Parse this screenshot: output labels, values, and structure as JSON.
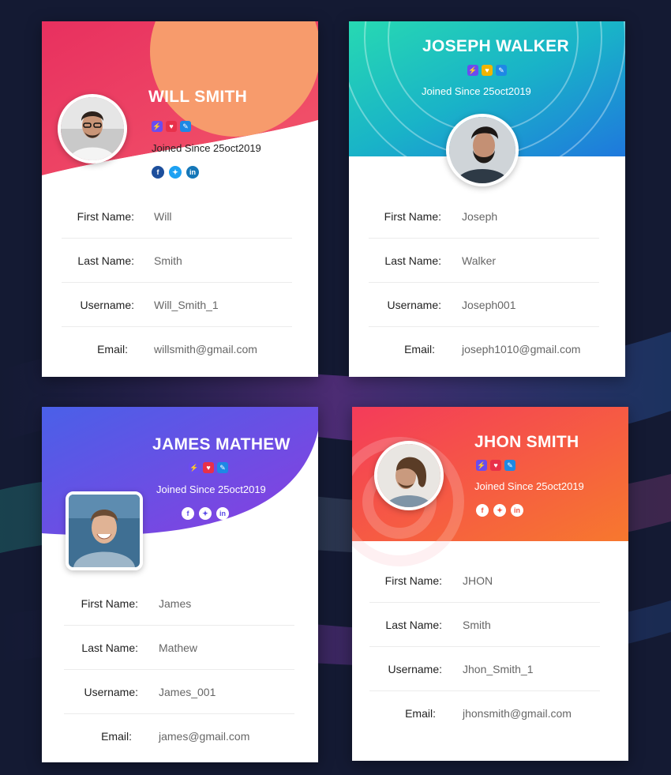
{
  "cards": [
    {
      "name": "WILL SMITH",
      "joined": "Joined Since 25oct2019",
      "badges": [
        "lightning-icon",
        "heart-icon",
        "pen-icon"
      ],
      "socials": [
        "facebook-icon",
        "twitter-icon",
        "linkedin-icon"
      ],
      "fields": [
        {
          "label": "First Name:",
          "value": "Will"
        },
        {
          "label": "Last Name:",
          "value": "Smith"
        },
        {
          "label": "Username:",
          "value": "Will_Smith_1"
        },
        {
          "label": "Email:",
          "value": "willsmith@gmail.com"
        }
      ]
    },
    {
      "name": "JOSEPH WALKER",
      "joined": "Joined Since 25oct2019",
      "badges": [
        "lightning-icon",
        "heart-icon",
        "pen-icon"
      ],
      "fields": [
        {
          "label": "First Name:",
          "value": "Joseph"
        },
        {
          "label": "Last Name:",
          "value": "Walker"
        },
        {
          "label": "Username:",
          "value": "Joseph001"
        },
        {
          "label": "Email:",
          "value": "joseph1010@gmail.com"
        }
      ]
    },
    {
      "name": "JAMES  MATHEW",
      "joined": "Joined Since 25oct2019",
      "badges": [
        "lightning-icon",
        "heart-icon",
        "pen-icon"
      ],
      "socials": [
        "facebook-icon",
        "twitter-icon",
        "linkedin-icon"
      ],
      "fields": [
        {
          "label": "First Name:",
          "value": "James"
        },
        {
          "label": "Last Name:",
          "value": "Mathew"
        },
        {
          "label": "Username:",
          "value": "James_001"
        },
        {
          "label": "Email:",
          "value": "james@gmail.com"
        }
      ]
    },
    {
      "name": "JHON SMITH",
      "joined": "Joined Since 25oct2019",
      "badges": [
        "lightning-icon",
        "heart-icon",
        "pen-icon"
      ],
      "socials": [
        "facebook-icon",
        "twitter-icon",
        "linkedin-icon"
      ],
      "fields": [
        {
          "label": "First Name:",
          "value": "JHON"
        },
        {
          "label": "Last Name:",
          "value": "Smith"
        },
        {
          "label": "Username:",
          "value": "Jhon_Smith_1"
        },
        {
          "label": "Email:",
          "value": "jhonsmith@gmail.com"
        }
      ]
    }
  ],
  "colors": {
    "page_bg": "#141a33",
    "card1_pink": "#ec3e6a",
    "card1_orange": "#f79b6c",
    "card2_teal": "#2bd6b4",
    "card2_blue": "#1e7fdc",
    "card3_blue": "#4a64e8",
    "card3_purple": "#8a3ee0",
    "card4_red": "#f43b5a",
    "card4_orange": "#f7782e"
  }
}
